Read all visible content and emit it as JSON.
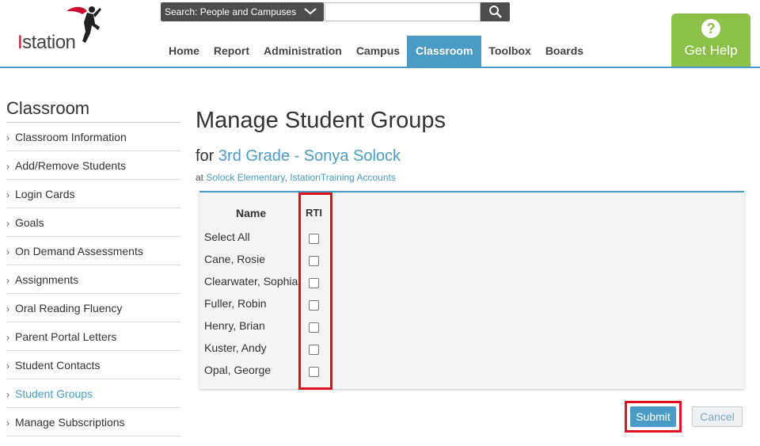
{
  "header": {
    "logo_prefix": "I",
    "logo_rest": "station",
    "search_scope": "Search: People and Campuses",
    "search_value": "",
    "nav": [
      "Home",
      "Report",
      "Administration",
      "Campus",
      "Classroom",
      "Toolbox",
      "Boards"
    ],
    "active_nav": "Classroom",
    "help_label": "Get Help",
    "help_icon": "?",
    "colors": {
      "accent": "#4a9cc7",
      "help": "#8dc049",
      "highlight": "#e01020"
    }
  },
  "sidebar": {
    "title": "Classroom",
    "items": [
      "Classroom Information",
      "Add/Remove Students",
      "Login Cards",
      "Goals",
      "On Demand Assessments",
      "Assignments",
      "Oral Reading Fluency",
      "Parent Portal Letters",
      "Student Contacts",
      "Student Groups",
      "Manage Subscriptions"
    ],
    "active_item": "Student Groups"
  },
  "main": {
    "title": "Manage Student Groups",
    "for_prefix": "for",
    "class_name": "3rd Grade - Sonya Solock",
    "at_prefix": "at",
    "school": "Solock Elementary",
    "separator": ",",
    "account": "IstationTraining Accounts",
    "table": {
      "col_name": "Name",
      "col_rti": "RTI",
      "rows": [
        {
          "label": "Select All",
          "checked": false
        },
        {
          "label": "Cane, Rosie",
          "checked": false
        },
        {
          "label": "Clearwater, Sophia",
          "checked": false
        },
        {
          "label": "Fuller, Robin",
          "checked": false
        },
        {
          "label": "Henry, Brian",
          "checked": false
        },
        {
          "label": "Kuster, Andy",
          "checked": false
        },
        {
          "label": "Opal, George",
          "checked": false
        }
      ]
    },
    "submit_label": "Submit",
    "cancel_label": "Cancel"
  }
}
